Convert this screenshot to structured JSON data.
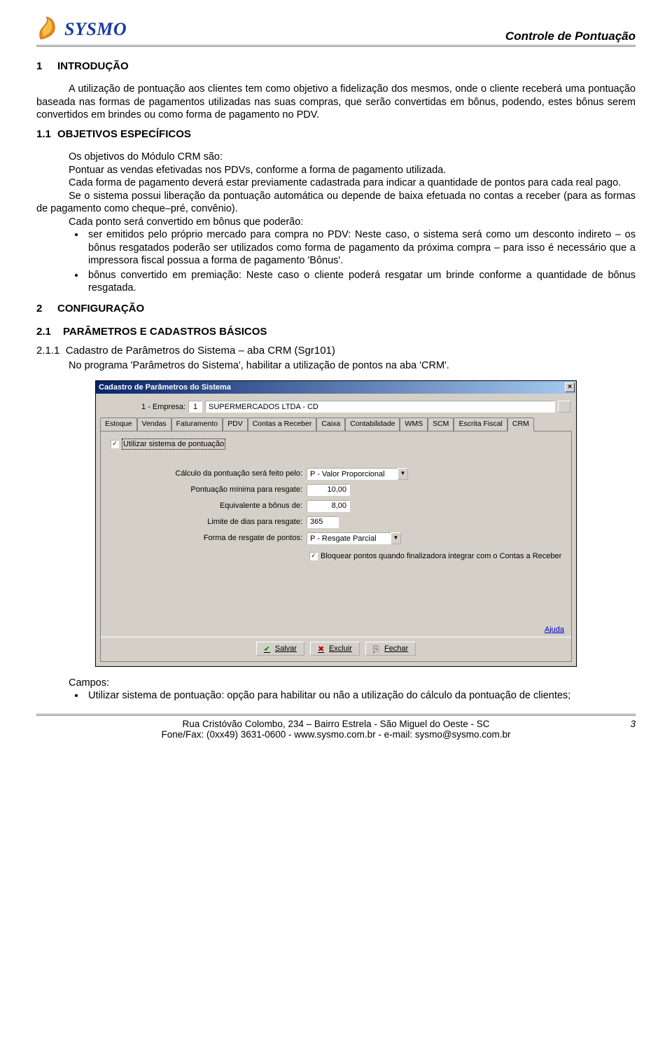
{
  "logo_text": "SYSMO",
  "doc_title": "Controle de Pontuação",
  "section1": {
    "num": "1",
    "title": "INTRODUÇÃO",
    "para": "A utilização de pontuação aos clientes tem como objetivo a fidelização dos mesmos, onde o cliente receberá uma pontuação baseada nas formas de pagamentos utilizadas nas suas compras, que serão convertidas em bônus, podendo, estes bônus serem convertidos em brindes ou como forma de pagamento no PDV."
  },
  "section1_1": {
    "num": "1.1",
    "title": "OBJETIVOS ESPECÍFICOS",
    "p1": "Os objetivos do Módulo CRM são:",
    "p2": "Pontuar as vendas efetivadas nos PDVs, conforme a forma de pagamento utilizada.",
    "p3": "Cada forma de pagamento deverá estar previamente cadastrada para indicar a quantidade de pontos para cada real pago.",
    "p4": "Se o sistema possui liberação da pontuação automática ou depende de baixa efetuada no contas a receber (para as formas de pagamento como cheque–pré, convênio).",
    "p5": "Cada ponto será convertido em bônus que poderão:",
    "b1": "ser emitidos pelo próprio mercado para compra no PDV: Neste caso, o sistema será como um desconto indireto – os bônus resgatados poderão ser utilizados como forma de pagamento da próxima compra – para isso é necessário que a impressora fiscal possua a forma de pagamento 'Bônus'.",
    "b2": "bônus convertido em premiação: Neste caso o cliente poderá resgatar um brinde conforme a quantidade de bônus resgatada."
  },
  "section2": {
    "num": "2",
    "title": "CONFIGURAÇÃO"
  },
  "section2_1": {
    "num": "2.1",
    "title": "PARÂMETROS E CADASTROS BÁSICOS"
  },
  "section2_1_1": {
    "num": "2.1.1",
    "title": "Cadastro de Parâmetros do Sistema – aba CRM (Sgr101)",
    "para": "No programa 'Parâmetros do Sistema', habilitar a utilização de pontos na aba 'CRM'."
  },
  "win": {
    "title": "Cadastro de Parâmetros do Sistema",
    "emp_label": "1 - Empresa:",
    "emp_code": "1",
    "emp_name": "SUPERMERCADOS LTDA - CD",
    "tabs": [
      "Estoque",
      "Vendas",
      "Faturamento",
      "PDV",
      "Contas a Receber",
      "Caixa",
      "Contabilidade",
      "WMS",
      "SCM",
      "Escrita Fiscal",
      "CRM"
    ],
    "chk_label": "Utilizar sistema de pontuação",
    "f1_label": "Cálculo da pontuação será feito pelo:",
    "f1_value": "P - Valor Proporcional",
    "f2_label": "Pontuação mínima para resgate:",
    "f2_value": "10,00",
    "f3_label": "Equivalente a bônus de:",
    "f3_value": "8,00",
    "f4_label": "Limite de dias para resgate:",
    "f4_value": "365",
    "f5_label": "Forma de resgate de pontos:",
    "f5_value": "P - Resgate Parcial",
    "bloquear_label": "Bloquear pontos quando finalizadora integrar com o Contas a Receber",
    "help": "Ajuda",
    "btn_save": "Salvar",
    "btn_del": "Excluir",
    "btn_close": "Fechar"
  },
  "campos": {
    "heading": "Campos:",
    "b1": "Utilizar sistema de pontuação: opção para habilitar ou não a utilização do cálculo da pontuação de clientes;"
  },
  "footer": {
    "line1": "Rua Cristóvão Colombo, 234 – Bairro Estrela - São Miguel do Oeste - SC",
    "line2": "Fone/Fax: (0xx49) 3631-0600 - www.sysmo.com.br - e-mail: sysmo@sysmo.com.br",
    "page": "3"
  }
}
